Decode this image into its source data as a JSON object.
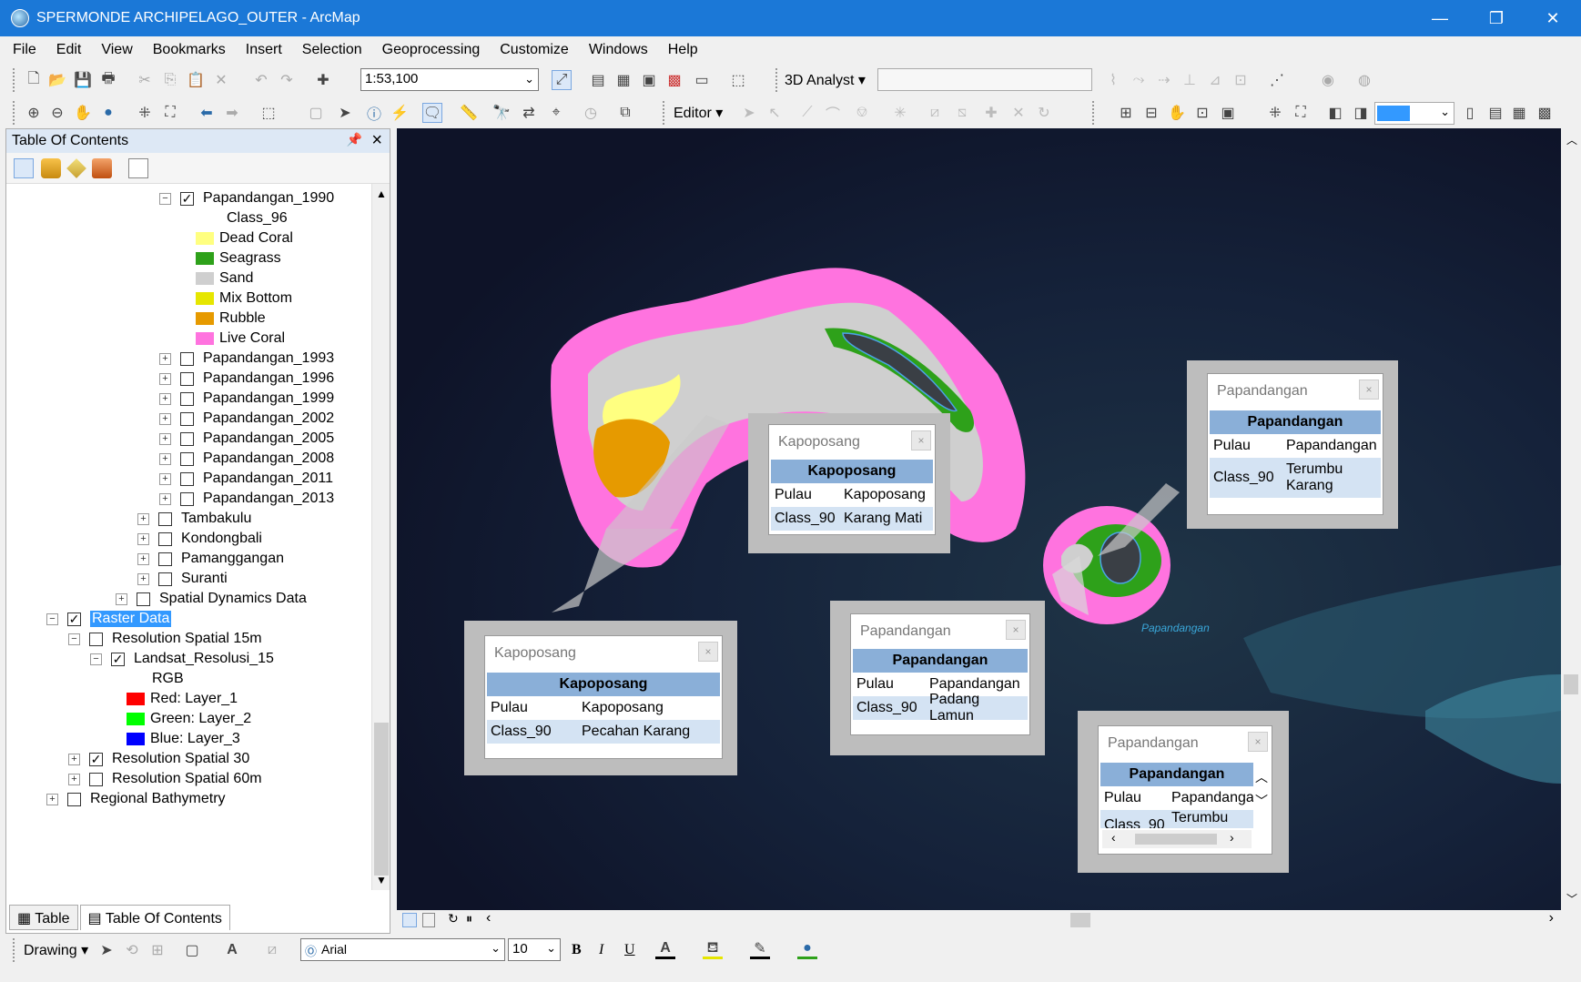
{
  "window": {
    "title": "SPERMONDE ARCHIPELAGO_OUTER - ArcMap",
    "minimize": "—",
    "restore": "❐",
    "close": "✕"
  },
  "menu": [
    "File",
    "Edit",
    "View",
    "Bookmarks",
    "Insert",
    "Selection",
    "Geoprocessing",
    "Customize",
    "Windows",
    "Help"
  ],
  "toolbar": {
    "scale": "1:53,100",
    "analyst_label": "3D Analyst ▾",
    "editor_label": "Editor ▾"
  },
  "toc": {
    "title": "Table Of Contents",
    "rows": [
      {
        "label": "Papandangan_1990",
        "exp": "⊟",
        "checked": true
      },
      {
        "label": "Class_96"
      },
      {
        "label": "Dead Coral",
        "color": "#ffff80"
      },
      {
        "label": "Seagrass",
        "color": "#2ea11a"
      },
      {
        "label": "Sand",
        "color": "#cfcfcf"
      },
      {
        "label": "Mix Bottom",
        "color": "#e6e600"
      },
      {
        "label": "Rubble",
        "color": "#e69a00"
      },
      {
        "label": "Live Coral",
        "color": "#ff73df"
      },
      {
        "label": "Papandangan_1993",
        "exp": "⊞",
        "checked": false
      },
      {
        "label": "Papandangan_1996",
        "exp": "⊞",
        "checked": false
      },
      {
        "label": "Papandangan_1999",
        "exp": "⊞",
        "checked": false
      },
      {
        "label": "Papandangan_2002",
        "exp": "⊞",
        "checked": false
      },
      {
        "label": "Papandangan_2005",
        "exp": "⊞",
        "checked": false
      },
      {
        "label": "Papandangan_2008",
        "exp": "⊞",
        "checked": false
      },
      {
        "label": "Papandangan_2011",
        "exp": "⊞",
        "checked": false
      },
      {
        "label": "Papandangan_2013",
        "exp": "⊞",
        "checked": false
      },
      {
        "label": "Tambakulu",
        "exp": "⊞",
        "checked": false
      },
      {
        "label": "Kondongbali",
        "exp": "⊞",
        "checked": false
      },
      {
        "label": "Pamanggangan",
        "exp": "⊞",
        "checked": false
      },
      {
        "label": "Suranti",
        "exp": "⊞",
        "checked": false
      },
      {
        "label": "Spatial Dynamics Data",
        "exp": "⊞",
        "checked": false
      },
      {
        "label": "Raster Data",
        "exp": "⊟",
        "checked": true,
        "selected": true
      },
      {
        "label": "Resolution Spatial 15m",
        "exp": "⊟",
        "checked": false
      },
      {
        "label": "Landsat_Resolusi_15",
        "exp": "⊟",
        "checked": true
      },
      {
        "label": "RGB"
      },
      {
        "label": "Red:   Layer_1",
        "color": "#ff0000"
      },
      {
        "label": "Green: Layer_2",
        "color": "#00ff00"
      },
      {
        "label": "Blue:   Layer_3",
        "color": "#0000ff"
      },
      {
        "label": "Resolution Spatial 30",
        "exp": "⊞",
        "checked": true
      },
      {
        "label": "Resolution Spatial 60m",
        "exp": "⊞",
        "checked": false
      },
      {
        "label": "Regional Bathymetry",
        "exp": "⊞",
        "checked": false
      }
    ],
    "tab_table": "Table",
    "tab_toc": "Table Of Contents"
  },
  "popups": [
    {
      "title": "Kapoposang",
      "header": "Kapoposang",
      "rows": [
        [
          "Pulau",
          "Kapoposang"
        ],
        [
          "Class_90",
          "Karang Mati"
        ]
      ]
    },
    {
      "title": "Papandangan",
      "header": "Papandangan",
      "rows": [
        [
          "Pulau",
          "Papandangan"
        ],
        [
          "Class_90",
          "Terumbu Karang"
        ]
      ]
    },
    {
      "title": "Kapoposang",
      "header": "Kapoposang",
      "rows": [
        [
          "Pulau",
          "Kapoposang"
        ],
        [
          "Class_90",
          "Pecahan Karang"
        ]
      ]
    },
    {
      "title": "Papandangan",
      "header": "Papandangan",
      "rows": [
        [
          "Pulau",
          "Papandangan"
        ],
        [
          "Class_90",
          "Padang Lamun"
        ]
      ]
    },
    {
      "title": "Papandangan",
      "header": "Papandangan",
      "rows": [
        [
          "Pulau",
          "Papandangan"
        ],
        [
          "Class_90",
          "Terumbu"
        ]
      ]
    }
  ],
  "map_label": "Papandangan",
  "drawing": {
    "label": "Drawing ▾",
    "font": "Arial",
    "size": "10",
    "bold": "B",
    "italic": "I",
    "underline": "U"
  }
}
